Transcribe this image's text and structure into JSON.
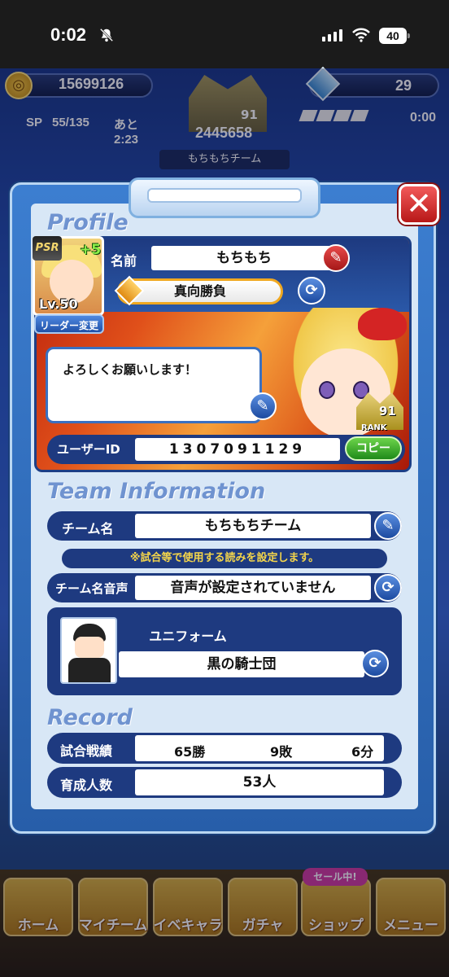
{
  "status": {
    "time": "0:02",
    "battery": "40"
  },
  "hud": {
    "coins": "15699126",
    "gems": "29",
    "sp_label": "SP",
    "sp_value": "55/135",
    "sp_time": "あと 2:23",
    "rank_label": "RANK",
    "rank_value": "91",
    "rank_points": "2445658",
    "team_name_label": "もちもちチーム",
    "timer_label": "あと",
    "timer_value": "0:00"
  },
  "nav": {
    "items": [
      {
        "label": "ホーム"
      },
      {
        "label": "マイチーム"
      },
      {
        "label": "イベキャラ"
      },
      {
        "label": "ガチャ"
      },
      {
        "label": "ショップ"
      },
      {
        "label": "メニュー"
      }
    ],
    "sale_badge": "セール中!"
  },
  "dialog": {
    "close_icon": "close-x",
    "profile": {
      "heading": "Profile",
      "psr": "PSR",
      "plus": "+5",
      "level": "Lv.50",
      "leader_change": "リーダー変更",
      "name_label": "名前",
      "name_value": "もちもち",
      "title_value": "真向勝負",
      "comment": "よろしくお願いします！",
      "rank_value": "91",
      "rank_label": "RANK",
      "user_id_label": "ユーザーID",
      "user_id_value": "1307091129",
      "copy_label": "コピー"
    },
    "team": {
      "heading": "Team Information",
      "team_name_label": "チーム名",
      "team_name_value": "もちもちチーム",
      "notice": "※試合等で使用する読みを設定します。",
      "voice_label": "チーム名音声",
      "voice_value": "音声が設定されていません",
      "uniform_label": "ユニフォーム",
      "uniform_value": "黒の騎士団"
    },
    "record": {
      "heading": "Record",
      "results_label": "試合戦績",
      "wins": "65勝",
      "losses": "9敗",
      "draws": "6分",
      "trained_label": "育成人数",
      "trained_value": "53人"
    }
  },
  "colors": {
    "accent_red": "#d42424",
    "panel_navy": "#1e3a80",
    "copy_green": "#1f8a1a"
  }
}
